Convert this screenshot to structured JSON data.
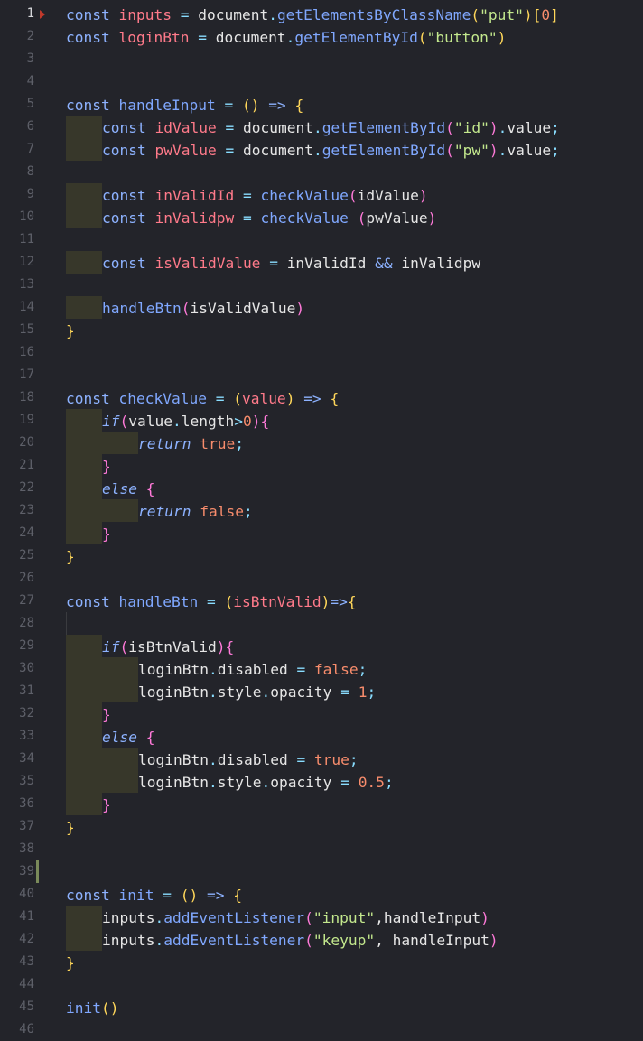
{
  "editor": {
    "line_numbers": [
      "1",
      "2",
      "3",
      "4",
      "5",
      "6",
      "7",
      "8",
      "9",
      "10",
      "11",
      "12",
      "13",
      "14",
      "15",
      "16",
      "17",
      "18",
      "19",
      "20",
      "21",
      "22",
      "23",
      "24",
      "25",
      "26",
      "27",
      "28",
      "29",
      "30",
      "31",
      "32",
      "33",
      "34",
      "35",
      "36",
      "37",
      "38",
      "39",
      "40",
      "41",
      "42",
      "43",
      "44",
      "45",
      "46"
    ],
    "code": {
      "l1": [
        "const",
        "inputs",
        "=",
        "document",
        ".",
        "getElementsByClassName",
        "(",
        "\"put\"",
        ")",
        "[",
        "0",
        "]"
      ],
      "l2": [
        "const",
        "loginBtn",
        "=",
        "document",
        ".",
        "getElementById",
        "(",
        "\"button\"",
        ")"
      ],
      "l5": [
        "const",
        "handleInput",
        "=",
        "(",
        ")",
        "=>",
        "{"
      ],
      "l6": [
        "const",
        "idValue",
        "=",
        "document",
        ".",
        "getElementById",
        "(",
        "\"id\"",
        ")",
        ".",
        "value",
        ";"
      ],
      "l7": [
        "const",
        "pwValue",
        "=",
        "document",
        ".",
        "getElementById",
        "(",
        "\"pw\"",
        ")",
        ".",
        "value",
        ";"
      ],
      "l9": [
        "const",
        "inValidId",
        "=",
        "checkValue",
        "(",
        "idValue",
        ")"
      ],
      "l10": [
        "const",
        "inValidpw",
        "=",
        "checkValue",
        " (",
        "pwValue",
        ")"
      ],
      "l12": [
        "const",
        "isValidValue",
        "=",
        "inValidId",
        "&&",
        "inValidpw"
      ],
      "l14": [
        "handleBtn",
        "(",
        "isValidValue",
        ")"
      ],
      "l15": [
        "}"
      ],
      "l18": [
        "const",
        "checkValue",
        "=",
        "(",
        "value",
        ")",
        "=>",
        "{"
      ],
      "l19": [
        "if",
        "(",
        "value",
        ".",
        "length",
        ">",
        "0",
        ")",
        "{"
      ],
      "l20": [
        "return",
        "true",
        ";"
      ],
      "l21": [
        "}"
      ],
      "l22": [
        "else",
        "{"
      ],
      "l23": [
        "return",
        "false",
        ";"
      ],
      "l24": [
        "}"
      ],
      "l25": [
        "}"
      ],
      "l27": [
        "const",
        "handleBtn",
        "=",
        "(",
        "isBtnValid",
        ")",
        "=>",
        "{"
      ],
      "l29": [
        "if",
        "(",
        "isBtnValid",
        ")",
        "{"
      ],
      "l30": [
        "loginBtn",
        ".",
        "disabled",
        "=",
        "false",
        ";"
      ],
      "l31": [
        "loginBtn",
        ".",
        "style",
        ".",
        "opacity",
        "=",
        "1",
        ";"
      ],
      "l32": [
        "}"
      ],
      "l33": [
        "else",
        "{"
      ],
      "l34": [
        "loginBtn",
        ".",
        "disabled",
        "=",
        "true",
        ";"
      ],
      "l35": [
        "loginBtn",
        ".",
        "style",
        ".",
        "opacity",
        "=",
        "0.5",
        ";"
      ],
      "l36": [
        "}"
      ],
      "l37": [
        "}"
      ],
      "l40": [
        "const",
        "init",
        "=",
        "(",
        ")",
        "=>",
        "{"
      ],
      "l41": [
        "inputs",
        ".",
        "addEventListener",
        "(",
        "\"input\"",
        ",",
        "handleInput",
        ")"
      ],
      "l42": [
        "inputs",
        ".",
        "addEventListener",
        "(",
        "\"keyup\"",
        ",",
        "handleInput",
        ")"
      ],
      "l43": [
        "}"
      ],
      "l45": [
        "init",
        "(",
        ")"
      ]
    }
  },
  "colors": {
    "background": "#23242a",
    "line_number": "#5e6069",
    "keyword": "#8db2ff",
    "string": "#c3e88d",
    "number": "#f78c6c",
    "variable": "#ff7a8a",
    "bracket": "#ffd75a",
    "indent_guide": "#37372a"
  }
}
